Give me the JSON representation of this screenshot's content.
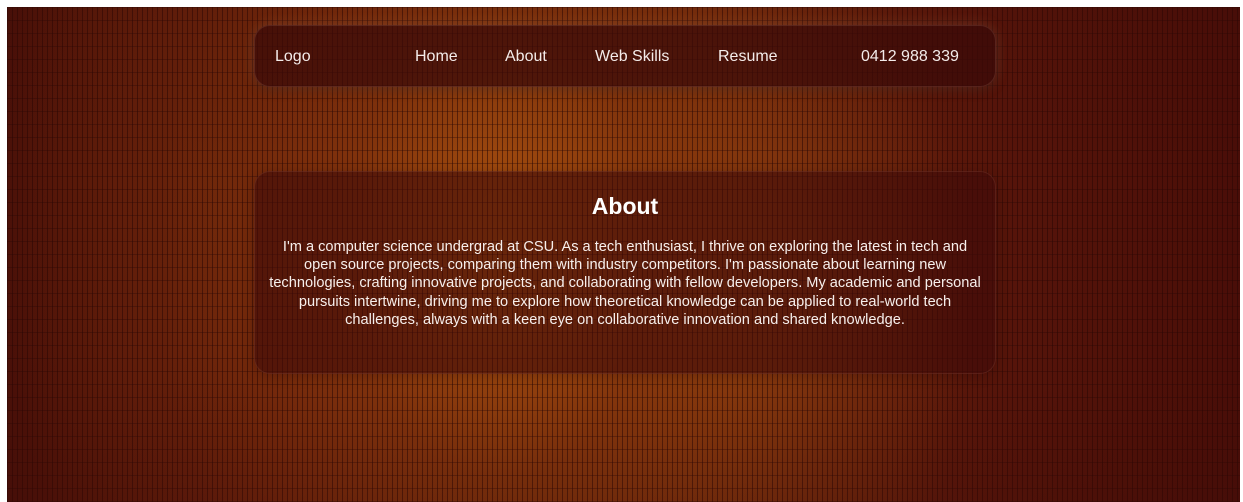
{
  "nav": {
    "logo": "Logo",
    "links": [
      {
        "label": "Home"
      },
      {
        "label": "About"
      },
      {
        "label": "Web Skills"
      },
      {
        "label": "Resume"
      }
    ],
    "phone": "0412 988 339"
  },
  "about": {
    "title": "About",
    "body": "I'm a computer science undergrad at CSU. As a tech enthusiast, I thrive on exploring the latest in tech and open source projects, comparing them with industry competitors. I'm passionate about learning new technologies, crafting innovative projects, and collaborating with fellow developers. My academic and personal pursuits intertwine, driving me to explore how theoretical knowledge can be applied to real-world tech challenges, always with a keen eye on collaborative innovation and shared knowledge."
  },
  "theme": {
    "background_dark": "#4a1008",
    "background_glow": "#aa520e",
    "panel": "#3a0a08",
    "text": "#f4ecea"
  }
}
